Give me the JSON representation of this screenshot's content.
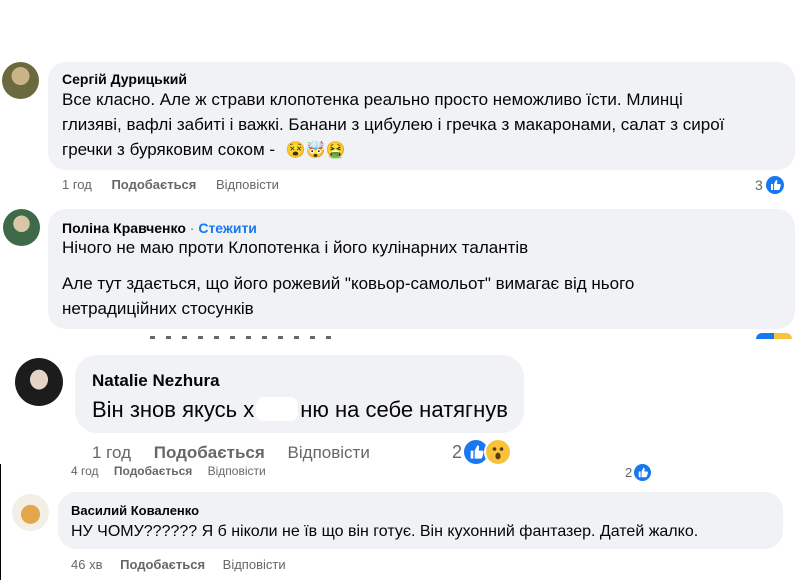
{
  "comments": [
    {
      "author": "Сергій Дурицький",
      "lines": [
        "Все класно. Але ж страви клопотенка реально просто неможливо їсти. Млинці",
        "глизяві, вафлі забиті і важкі. Банани з цибулею і гречка з макаронами, салат з сирої",
        "гречки з буряковим соком -"
      ],
      "emojis": [
        "😵",
        "🤯",
        "🤮"
      ],
      "time": "1 год",
      "like_label": "Подобається",
      "reply_label": "Відповісти",
      "reaction_count": "3"
    },
    {
      "author": "Поліна Кравченко",
      "separator": "·",
      "follow_label": "Стежити",
      "lines": [
        "Нічого не маю проти Клопотенка і його кулінарних талантів",
        "Але тут здається, що його рожевий \"ковьор-самольот\" вимагає від нього",
        "нетрадиційних стосунків"
      ]
    },
    {
      "author": "Natalie Nezhura",
      "text_before": "Він знов якусь х",
      "text_after": "ню на себе натягнув",
      "time": "1 год",
      "like_label": "Подобається",
      "reply_label": "Відповісти",
      "reaction_count": "2"
    },
    {
      "time": "4 год",
      "like_label": "Подобається",
      "reply_label": "Відповісти",
      "reaction_count": "2"
    },
    {
      "author": "Василий Коваленко",
      "text": "НУ ЧОМУ?????? Я б ніколи не їв що він готує. Він кухонний фантазер. Датей жалко.",
      "time": "46 хв",
      "like_label": "Подобається",
      "reply_label": "Відповісти"
    }
  ],
  "colors": {
    "bubble": "#f0f2f5",
    "meta": "#65676b",
    "link": "#1877f2",
    "like_blue": "#1877f2",
    "wow_yellow": "#f7c33b"
  },
  "icons": [
    "like-icon",
    "wow-icon",
    "avatar"
  ]
}
